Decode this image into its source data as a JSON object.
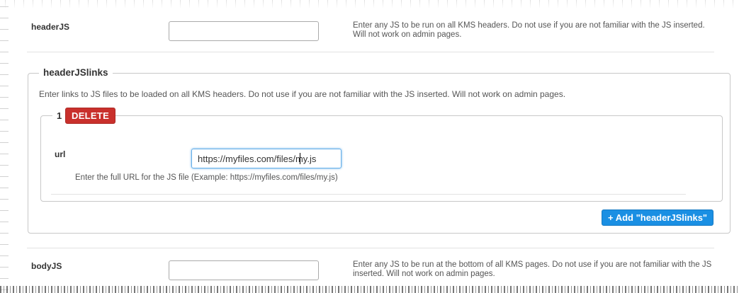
{
  "header_js": {
    "label": "headerJS",
    "value": "",
    "help": "Enter any JS to be run on all KMS headers. Do not use if you are not familiar with the JS inserted. Will not work on admin pages."
  },
  "header_js_links": {
    "legend": "headerJSlinks",
    "description": "Enter links to JS files to be loaded on all KMS headers. Do not use if you are not familiar with the JS inserted. Will not work on admin pages.",
    "item": {
      "index": "1",
      "delete_label": "DELETE",
      "url_label": "url",
      "url_value": "https://myfiles.com/files/my.js",
      "url_help": "Enter the full URL for the JS file (Example: https://myfiles.com/files/my.js)"
    },
    "add_label": "+ Add \"headerJSlinks\""
  },
  "body_js": {
    "label": "bodyJS",
    "value": "",
    "help": "Enter any JS to be run at the bottom of all KMS pages. Do not use if you are not familiar with the JS inserted. Will not work on admin pages."
  },
  "colors": {
    "delete": "#c9302c",
    "add": "#1a8fe3"
  }
}
